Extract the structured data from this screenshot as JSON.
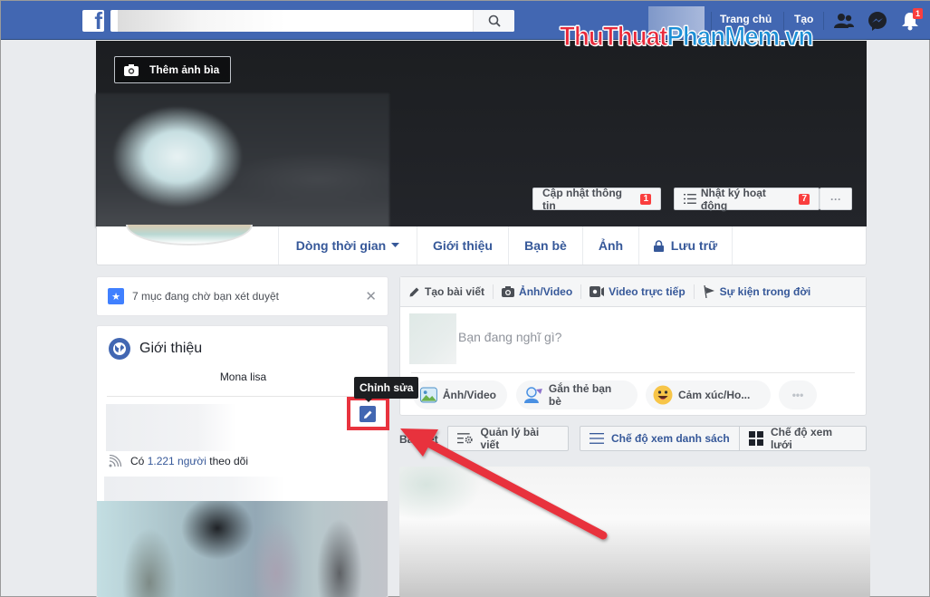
{
  "topbar": {
    "logo": "f",
    "search_placeholder": "",
    "nav": {
      "home": "Trang chủ",
      "create": "Tạo"
    },
    "notifications_count": "1",
    "icons": [
      "friend-requests-icon",
      "messenger-icon",
      "notifications-icon"
    ]
  },
  "watermark": {
    "part1": "ThuThuat",
    "part2": "PhanMem",
    "part3": ".vn"
  },
  "cover": {
    "add_cover_label": "Thêm ảnh bìa",
    "update_info_label": "Cập nhật thông tin",
    "update_info_badge": "1",
    "activity_log_label": "Nhật ký hoạt động",
    "activity_log_badge": "7",
    "more_label": "···"
  },
  "tabs": [
    {
      "label": "Dòng thời gian",
      "icon": "caret-down-icon"
    },
    {
      "label": "Giới thiệu"
    },
    {
      "label": "Bạn bè"
    },
    {
      "label": "Ảnh"
    },
    {
      "label": "Lưu trữ",
      "icon": "lock-icon"
    }
  ],
  "review": {
    "text": "7 mục đang chờ bạn xét duyệt",
    "close": "✕"
  },
  "intro": {
    "title": "Giới thiệu",
    "bio": "Mona lisa",
    "followers_prefix": "Có ",
    "followers_link": "1.221 người",
    "followers_suffix": " theo dõi",
    "edit_tooltip": "Chỉnh sửa"
  },
  "composer": {
    "tabs": [
      {
        "label": "Tạo bài viết",
        "icon": "pencil-icon"
      },
      {
        "label": "Ảnh/Video",
        "icon": "camera-icon"
      },
      {
        "label": "Video trực tiếp",
        "icon": "live-video-icon"
      },
      {
        "label": "Sự kiện trong đời",
        "icon": "flag-icon"
      }
    ],
    "placeholder": "Bạn đang nghĩ gì?",
    "actions": [
      {
        "label": "Ảnh/Video",
        "icon": "photo-icon"
      },
      {
        "label": "Gắn thẻ bạn bè",
        "icon": "tag-friends-icon"
      },
      {
        "label": "Cảm xúc/Ho...",
        "icon": "emoji-icon"
      },
      {
        "label": "•••",
        "icon": "more-icon"
      }
    ]
  },
  "posts_toolbar": {
    "label": "Bài viết",
    "manage_posts": "Quản lý bài viết",
    "list_view": "Chế độ xem danh sách",
    "grid_view": "Chế độ xem lưới"
  },
  "colors": {
    "brand": "#4267b2",
    "link": "#365899",
    "badge": "#fa3e3e",
    "annotation": "#e8333e"
  }
}
